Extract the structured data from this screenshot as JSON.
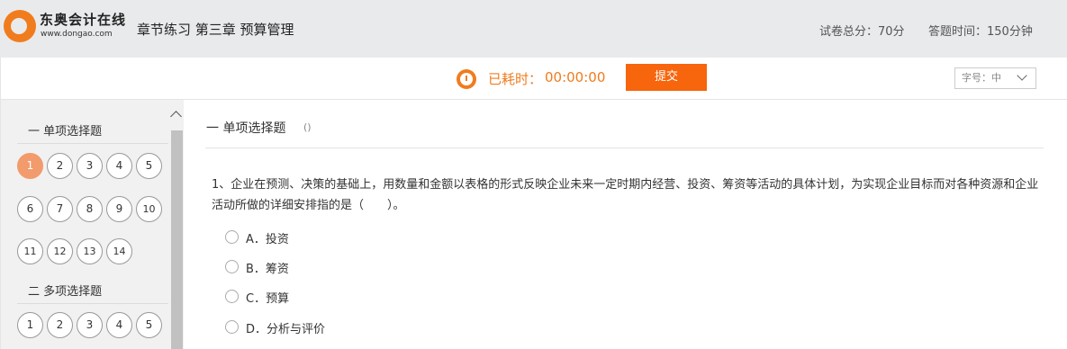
{
  "header": {
    "logo_cn": "东奥会计在线",
    "logo_en": "www.dongao.com",
    "title": "章节练习 第三章 预算管理",
    "total_score": "试卷总分：70分",
    "duration": "答题时间：150分钟"
  },
  "timer": {
    "label": "已耗时：",
    "value": "00:00:00",
    "submit_label": "提交",
    "font_size_label": "字号：中"
  },
  "sidebar": {
    "sections": [
      {
        "title": "一 单项选择题",
        "questions": [
          "1",
          "2",
          "3",
          "4",
          "5",
          "6",
          "7",
          "8",
          "9",
          "10",
          "11",
          "12",
          "13",
          "14"
        ],
        "active": "1"
      },
      {
        "title": "二 多项选择题",
        "questions": [
          "1",
          "2",
          "3",
          "4",
          "5"
        ]
      }
    ]
  },
  "main": {
    "section_title": "一 单项选择题",
    "section_note": "()",
    "question": "1、企业在预测、决策的基础上，用数量和金额以表格的形式反映企业未来一定时期内经营、投资、筹资等活动的具体计划，为实现企业目标而对各种资源和企业活动所做的详细安排指的是（　　）。",
    "options": [
      "A．投资",
      "B．筹资",
      "C．预算",
      "D．分析与评价"
    ]
  },
  "colors": {
    "accent": "#f7650c",
    "timer": "#f07c1e",
    "active_question": "#f29b6d"
  }
}
